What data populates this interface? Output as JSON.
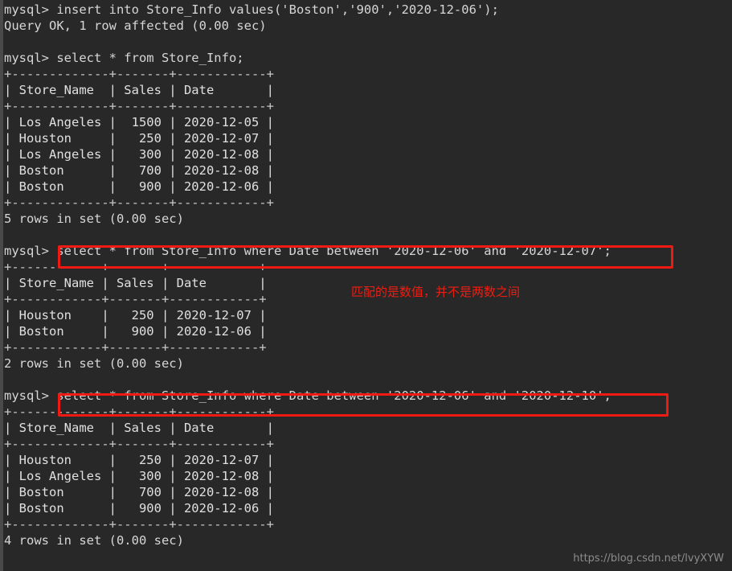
{
  "terminal": {
    "prompt": "mysql> ",
    "lines": [
      {
        "id": "cmd-insert",
        "text": "mysql> insert into Store_Info values('Boston','900','2020-12-06');",
        "kind": "command"
      },
      {
        "id": "result-insert",
        "text": "Query OK, 1 row affected (0.00 sec)",
        "kind": "status"
      },
      {
        "id": "blank-1",
        "text": "",
        "kind": "blank"
      },
      {
        "id": "cmd-select-all",
        "text": "mysql> select * from Store_Info;",
        "kind": "command"
      },
      {
        "id": "t1-rule-top",
        "text": "+-------------+-------+------------+",
        "kind": "rule"
      },
      {
        "id": "t1-header",
        "text": "| Store_Name  | Sales | Date       |",
        "kind": "row"
      },
      {
        "id": "t1-rule-mid",
        "text": "+-------------+-------+------------+",
        "kind": "rule"
      },
      {
        "id": "t1-row-1",
        "text": "| Los Angeles |  1500 | 2020-12-05 |",
        "kind": "row"
      },
      {
        "id": "t1-row-2",
        "text": "| Houston     |   250 | 2020-12-07 |",
        "kind": "row"
      },
      {
        "id": "t1-row-3",
        "text": "| Los Angeles |   300 | 2020-12-08 |",
        "kind": "row"
      },
      {
        "id": "t1-row-4",
        "text": "| Boston      |   700 | 2020-12-08 |",
        "kind": "row"
      },
      {
        "id": "t1-row-5",
        "text": "| Boston      |   900 | 2020-12-06 |",
        "kind": "row"
      },
      {
        "id": "t1-rule-bot",
        "text": "+-------------+-------+------------+",
        "kind": "rule"
      },
      {
        "id": "t1-count",
        "text": "5 rows in set (0.00 sec)",
        "kind": "status"
      },
      {
        "id": "blank-2",
        "text": "",
        "kind": "blank"
      },
      {
        "id": "cmd-between-1",
        "text": "mysql> select * from Store_Info where Date between '2020-12-06' and '2020-12-07';",
        "kind": "command"
      },
      {
        "id": "t2-rule-top",
        "text": "+------------+-------+------------+",
        "kind": "rule"
      },
      {
        "id": "t2-header",
        "text": "| Store_Name | Sales | Date       |",
        "kind": "row"
      },
      {
        "id": "t2-rule-mid",
        "text": "+------------+-------+------------+",
        "kind": "rule"
      },
      {
        "id": "t2-row-1",
        "text": "| Houston    |   250 | 2020-12-07 |",
        "kind": "row"
      },
      {
        "id": "t2-row-2",
        "text": "| Boston     |   900 | 2020-12-06 |",
        "kind": "row"
      },
      {
        "id": "t2-rule-bot",
        "text": "+------------+-------+------------+",
        "kind": "rule"
      },
      {
        "id": "t2-count",
        "text": "2 rows in set (0.00 sec)",
        "kind": "status"
      },
      {
        "id": "blank-3",
        "text": "",
        "kind": "blank"
      },
      {
        "id": "cmd-between-2",
        "text": "mysql> select * from Store_Info where Date between '2020-12-06' and '2020-12-10';",
        "kind": "command"
      },
      {
        "id": "t3-rule-top",
        "text": "+-------------+-------+------------+",
        "kind": "rule"
      },
      {
        "id": "t3-header",
        "text": "| Store_Name  | Sales | Date       |",
        "kind": "row"
      },
      {
        "id": "t3-rule-mid",
        "text": "+-------------+-------+------------+",
        "kind": "rule"
      },
      {
        "id": "t3-row-1",
        "text": "| Houston     |   250 | 2020-12-07 |",
        "kind": "row"
      },
      {
        "id": "t3-row-2",
        "text": "| Los Angeles |   300 | 2020-12-08 |",
        "kind": "row"
      },
      {
        "id": "t3-row-3",
        "text": "| Boston      |   700 | 2020-12-08 |",
        "kind": "row"
      },
      {
        "id": "t3-row-4",
        "text": "| Boston      |   900 | 2020-12-06 |",
        "kind": "row"
      },
      {
        "id": "t3-rule-bot",
        "text": "+-------------+-------+------------+",
        "kind": "rule"
      },
      {
        "id": "t3-count",
        "text": "4 rows in set (0.00 sec)",
        "kind": "status"
      }
    ]
  },
  "tables": [
    {
      "id": "store-info-full",
      "columns": [
        "Store_Name",
        "Sales",
        "Date"
      ],
      "rows": [
        [
          "Los Angeles",
          "1500",
          "2020-12-05"
        ],
        [
          "Houston",
          "250",
          "2020-12-07"
        ],
        [
          "Los Angeles",
          "300",
          "2020-12-08"
        ],
        [
          "Boston",
          "700",
          "2020-12-08"
        ],
        [
          "Boston",
          "900",
          "2020-12-06"
        ]
      ],
      "row_count_text": "5 rows in set (0.00 sec)"
    },
    {
      "id": "between-06-07",
      "columns": [
        "Store_Name",
        "Sales",
        "Date"
      ],
      "rows": [
        [
          "Houston",
          "250",
          "2020-12-07"
        ],
        [
          "Boston",
          "900",
          "2020-12-06"
        ]
      ],
      "row_count_text": "2 rows in set (0.00 sec)"
    },
    {
      "id": "between-06-10",
      "columns": [
        "Store_Name",
        "Sales",
        "Date"
      ],
      "rows": [
        [
          "Houston",
          "250",
          "2020-12-07"
        ],
        [
          "Los Angeles",
          "300",
          "2020-12-08"
        ],
        [
          "Boston",
          "700",
          "2020-12-08"
        ],
        [
          "Boston",
          "900",
          "2020-12-06"
        ]
      ],
      "row_count_text": "4 rows in set (0.00 sec)"
    }
  ],
  "annotations": {
    "note_text": "匹配的是数值，并不是两数之间",
    "note_color": "#f01c10",
    "highlight_color": "#ef1b12",
    "highlighted_query_1": "select * from Store_Info where Date between '2020-12-06' and '2020-12-07';",
    "highlighted_query_2": "select * from Store_Info where Date between '2020-12-06' and '2020-12-10';"
  },
  "watermark": {
    "text": "https://blog.csdn.net/lvyXYW"
  },
  "theme": {
    "background": "#282828",
    "foreground": "#d6d6d6",
    "bar_color": "#8fa8c8",
    "watermark_color": "#8c8c8c"
  }
}
